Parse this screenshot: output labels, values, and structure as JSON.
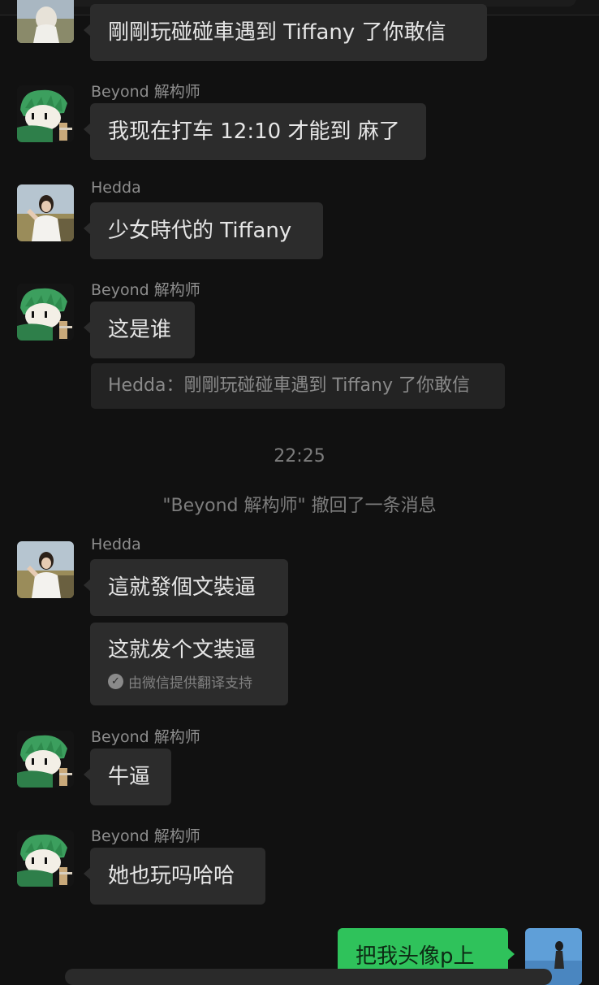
{
  "users": {
    "hedda": "Hedda",
    "beyond": "Beyond 解构师"
  },
  "messages": {
    "m0": "剛剛玩碰碰車遇到 Tiffany 了你敢信",
    "m1": "我现在打车 12:10 才能到 麻了",
    "m2": "少女時代的 Tiffany",
    "m3": "这是谁",
    "quote": "Hedda：剛剛玩碰碰車遇到 Tiffany 了你敢信",
    "time": "22:25",
    "recall": "\"Beyond 解构师\" 撤回了一条消息",
    "m4": "這就發個文裝逼",
    "m4_translation": "这就发个文装逼",
    "translation_note": "由微信提供翻译支持",
    "m5": "牛逼",
    "m6": "她也玩吗哈哈",
    "m7": "把我头像p上"
  },
  "icons": {
    "hedda_avatar": "photo-avatar",
    "beyond_avatar": "cartoon-avatar",
    "translate_check": "check-circle-icon"
  },
  "colors": {
    "background": "#111111",
    "bubble": "#2c2c2c",
    "my_bubble": "#2fc25b",
    "name_text": "#8d8d8d"
  }
}
